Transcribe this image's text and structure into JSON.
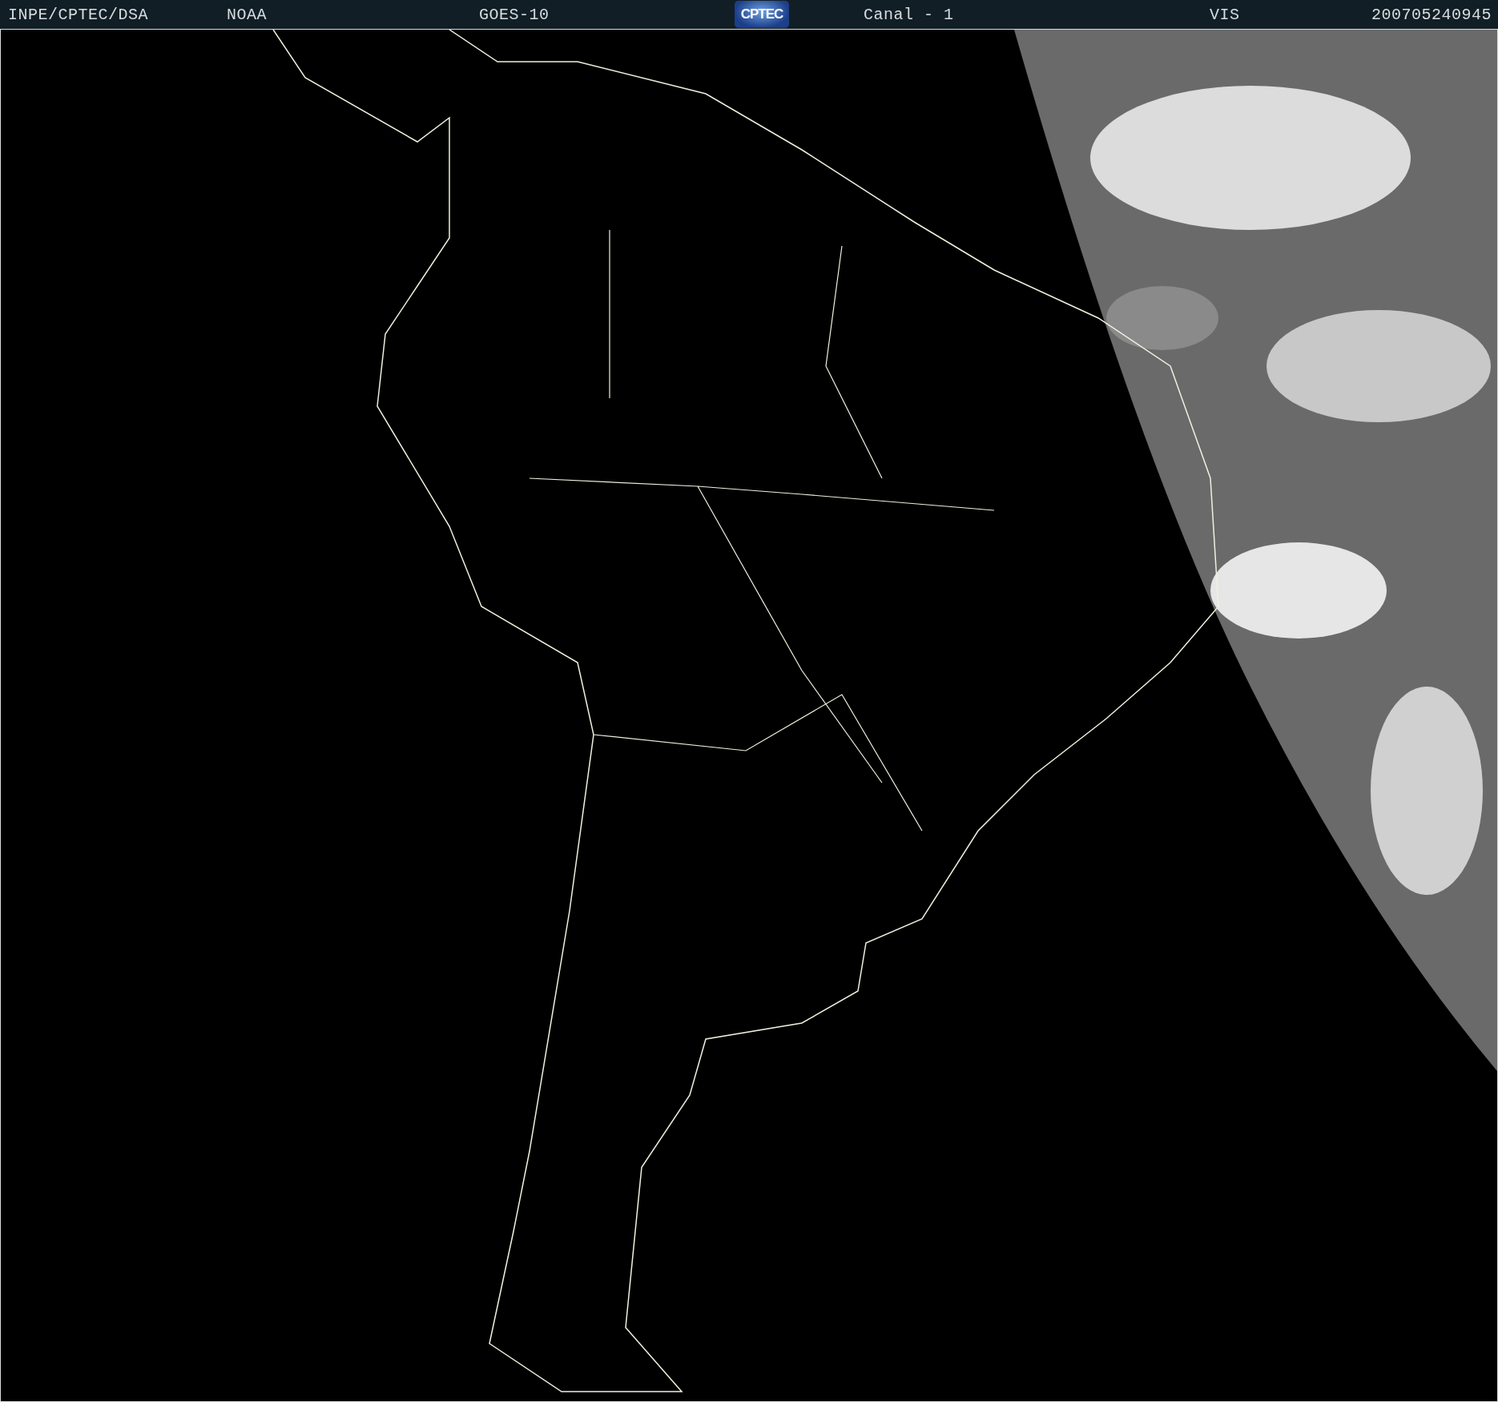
{
  "header": {
    "agency": "INPE/CPTEC/DSA",
    "source": "NOAA",
    "satellite": "GOES-10",
    "logo": "CPTEC",
    "channel": "Canal - 1",
    "band": "VIS",
    "timestamp": "200705240945"
  }
}
